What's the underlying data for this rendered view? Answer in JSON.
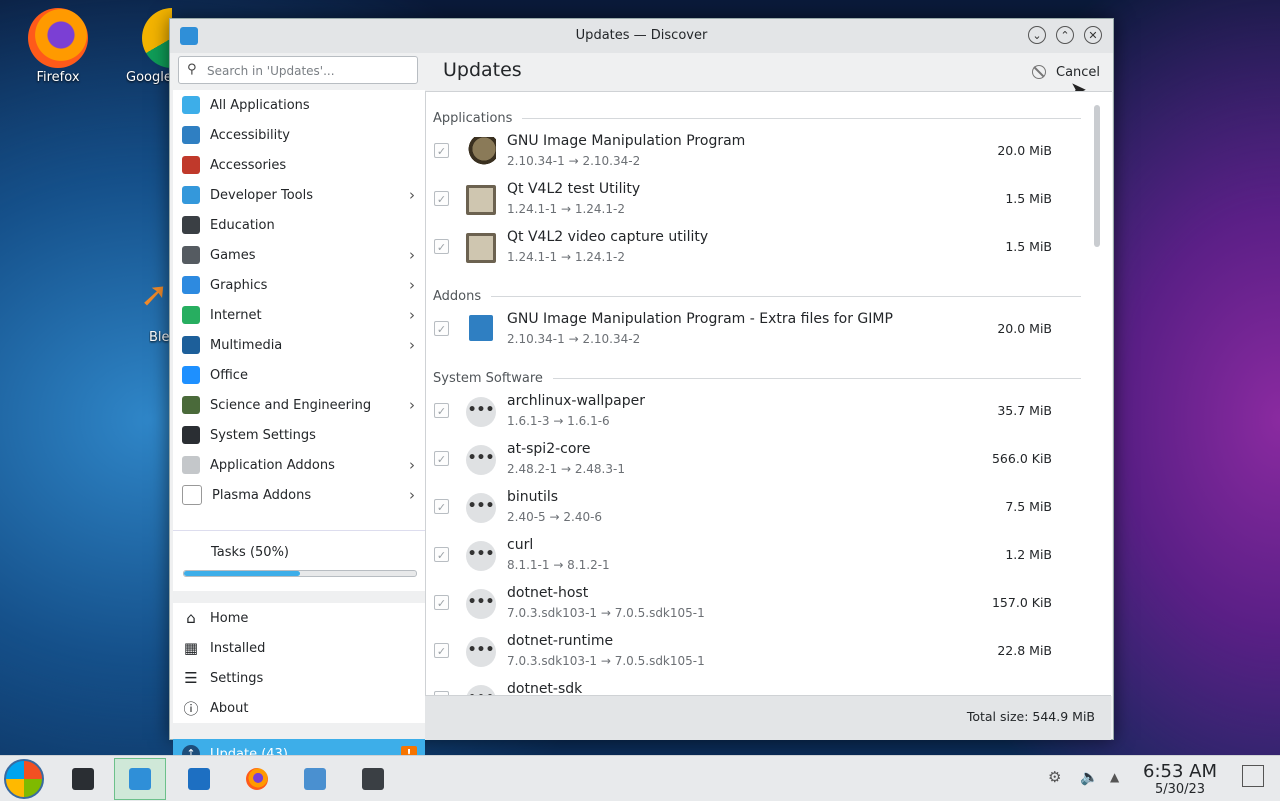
{
  "desktop": {
    "icons": [
      {
        "label": "Firefox"
      },
      {
        "label": "Google"
      },
      {
        "label": "Ble"
      }
    ]
  },
  "window": {
    "title": "Updates — Discover",
    "buttons": {
      "minimize": "⌄",
      "maximize": "⌃",
      "close": "✕"
    }
  },
  "search": {
    "placeholder": "Search in 'Updates'..."
  },
  "categories": [
    {
      "label": "All Applications",
      "icon": "grid-icon",
      "color": "#3daee9",
      "submenu": false
    },
    {
      "label": "Accessibility",
      "icon": "accessibility-icon",
      "color": "#2f7fc2",
      "submenu": false
    },
    {
      "label": "Accessories",
      "icon": "toolbox-icon",
      "color": "#c0392b",
      "submenu": false
    },
    {
      "label": "Developer Tools",
      "icon": "hammer-icon",
      "color": "#3498db",
      "submenu": true
    },
    {
      "label": "Education",
      "icon": "chalkboard-icon",
      "color": "#3a3f44",
      "submenu": false
    },
    {
      "label": "Games",
      "icon": "gamepad-icon",
      "color": "#555b61",
      "submenu": true
    },
    {
      "label": "Graphics",
      "icon": "graphics-icon",
      "color": "#2d8ae0",
      "submenu": true
    },
    {
      "label": "Internet",
      "icon": "globe-icon",
      "color": "#27ae60",
      "submenu": true
    },
    {
      "label": "Multimedia",
      "icon": "monitor-icon",
      "color": "#1d5f9a",
      "submenu": true
    },
    {
      "label": "Office",
      "icon": "document-icon",
      "color": "#1e90ff",
      "submenu": false
    },
    {
      "label": "Science and Engineering",
      "icon": "flask-icon",
      "color": "#4a6a3a",
      "submenu": true
    },
    {
      "label": "System Settings",
      "icon": "settings-window-icon",
      "color": "#2a2e33",
      "submenu": false
    },
    {
      "label": "Application Addons",
      "icon": "dots-icon",
      "color": "#c4c7ca",
      "submenu": true
    },
    {
      "label": "Plasma Addons",
      "icon": "plasma-icon",
      "color": "#ffffff",
      "submenu": true
    }
  ],
  "tasks": {
    "label": "Tasks (50%)",
    "progress": 0.5
  },
  "nav": [
    {
      "label": "Home",
      "icon": "home-icon",
      "glyph": "⌂"
    },
    {
      "label": "Installed",
      "icon": "installed-icon",
      "glyph": "▦"
    },
    {
      "label": "Settings",
      "icon": "sliders-icon",
      "glyph": "☰"
    },
    {
      "label": "About",
      "icon": "info-icon",
      "glyph": "ⓘ"
    }
  ],
  "update_nav": {
    "label": "Update (43)",
    "badge": "!"
  },
  "header": {
    "title": "Updates",
    "cancel_label": "Cancel"
  },
  "sections": [
    {
      "name": "Applications",
      "items": [
        {
          "name": "GNU Image Manipulation Program",
          "version": "2.10.34-1 → 2.10.34-2",
          "size": "20.0 MiB",
          "icon": "gimp"
        },
        {
          "name": "Qt V4L2 test Utility",
          "version": "1.24.1-1 → 1.24.1-2",
          "size": "1.5 MiB",
          "icon": "qt"
        },
        {
          "name": "Qt V4L2 video capture utility",
          "version": "1.24.1-1 → 1.24.1-2",
          "size": "1.5 MiB",
          "icon": "qt"
        }
      ]
    },
    {
      "name": "Addons",
      "items": [
        {
          "name": "GNU Image Manipulation Program - Extra files for GIMP",
          "version": "2.10.34-1 → 2.10.34-2",
          "size": "20.0 MiB",
          "icon": "extra"
        }
      ]
    },
    {
      "name": "System Software",
      "items": [
        {
          "name": "archlinux-wallpaper",
          "version": "1.6.1-3 → 1.6.1-6",
          "size": "35.7 MiB",
          "icon": "dots"
        },
        {
          "name": "at-spi2-core",
          "version": "2.48.2-1 → 2.48.3-1",
          "size": "566.0 KiB",
          "icon": "dots"
        },
        {
          "name": "binutils",
          "version": "2.40-5 → 2.40-6",
          "size": "7.5 MiB",
          "icon": "dots"
        },
        {
          "name": "curl",
          "version": "8.1.1-1 → 8.1.2-1",
          "size": "1.2 MiB",
          "icon": "dots"
        },
        {
          "name": "dotnet-host",
          "version": "7.0.3.sdk103-1 → 7.0.5.sdk105-1",
          "size": "157.0 KiB",
          "icon": "dots"
        },
        {
          "name": "dotnet-runtime",
          "version": "7.0.3.sdk103-1 → 7.0.5.sdk105-1",
          "size": "22.8 MiB",
          "icon": "dots"
        },
        {
          "name": "dotnet-sdk",
          "version": "",
          "size": "",
          "icon": "dots"
        }
      ]
    }
  ],
  "footer": {
    "total": "Total size: 544.9 MiB"
  },
  "taskbar": {
    "time": "6:53 AM",
    "date": "5/30/23"
  }
}
